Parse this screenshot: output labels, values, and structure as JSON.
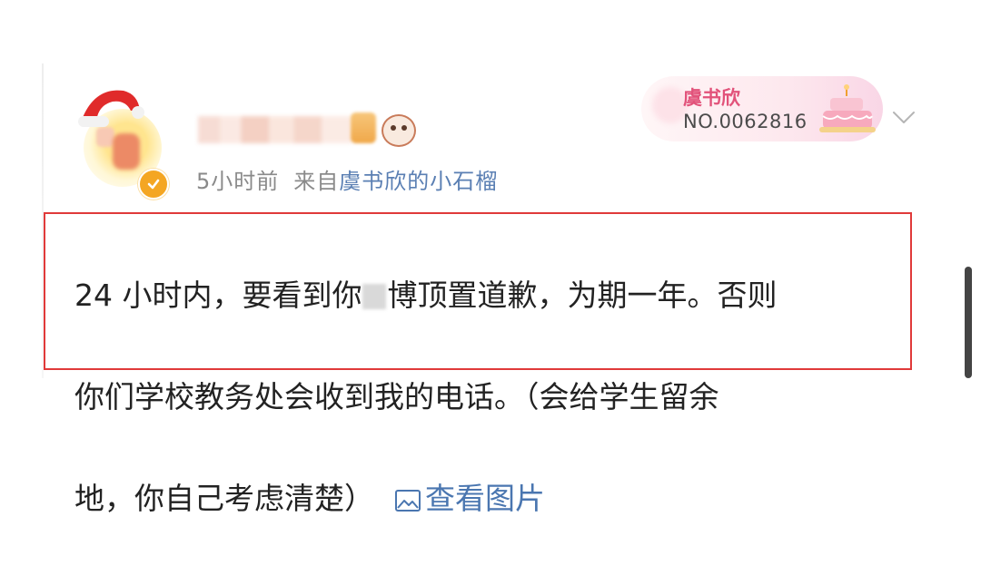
{
  "post": {
    "meta": {
      "time": "5小时前",
      "from_prefix": "来自",
      "from_source": "虞书欣的小石榴"
    },
    "fan_badge": {
      "name": "虞书欣",
      "number": "NO.0062816"
    },
    "content": {
      "line1_before": "24 小时内，要看到你",
      "line1_after": "博顶置道歉，为期一年。否则",
      "line2": "你们学校教务处会收到我的电话。（会给学生留余",
      "line3": "地，你自己考虑清楚）",
      "view_image_label": "查看图片"
    }
  },
  "colors": {
    "highlight_border": "#e03a3a",
    "link": "#4a76b0",
    "fan_name": "#e2527a",
    "verified": "#f4a623"
  },
  "icons": [
    "santa-hat-icon",
    "verified-icon",
    "cake-icon",
    "chevron-down-icon",
    "image-icon"
  ]
}
